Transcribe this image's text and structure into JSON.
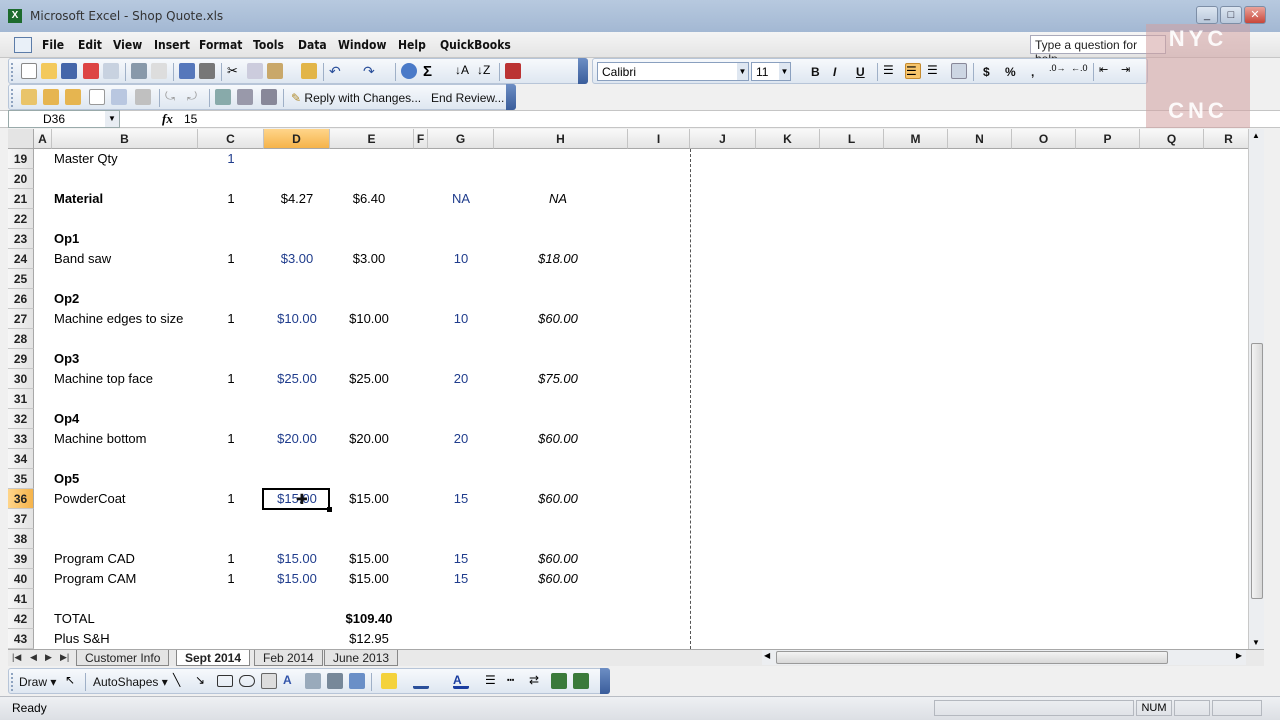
{
  "window": {
    "title": "Microsoft Excel - Shop Quote.xls",
    "app_icon": "excel-icon"
  },
  "menu": {
    "items": [
      "File",
      "Edit",
      "View",
      "Insert",
      "Format",
      "Tools",
      "Data",
      "Window",
      "Help",
      "QuickBooks"
    ],
    "help_placeholder": "Type a question for help"
  },
  "toolbar": {
    "font_name": "Calibri",
    "font_size": "11",
    "bold": "B",
    "italic": "I",
    "underline": "U",
    "currency": "$",
    "percent": "%",
    "comma": ",",
    "reply_label": "Reply with Changes...",
    "end_review_label": "End Review..."
  },
  "formula_bar": {
    "name_box": "D36",
    "fx": "fx",
    "value": "15"
  },
  "columns": [
    "A",
    "B",
    "C",
    "D",
    "E",
    "F",
    "G",
    "H",
    "I",
    "J",
    "K",
    "L",
    "M",
    "N",
    "O",
    "P",
    "Q",
    "R"
  ],
  "selected_column": "D",
  "selected_row": "36",
  "rows": [
    "19",
    "20",
    "21",
    "22",
    "23",
    "24",
    "25",
    "26",
    "27",
    "28",
    "29",
    "30",
    "31",
    "32",
    "33",
    "34",
    "35",
    "36",
    "37",
    "38",
    "39",
    "40",
    "41",
    "42",
    "43"
  ],
  "cells": {
    "r19": {
      "b": "Master Qty",
      "c": "1"
    },
    "r21": {
      "b": "Material",
      "c": "1",
      "d": "$4.27",
      "e": "$6.40",
      "g": "NA",
      "h": "NA"
    },
    "r23": {
      "b": "Op1"
    },
    "r24": {
      "b": "Band saw",
      "c": "1",
      "d": "$3.00",
      "e": "$3.00",
      "g": "10",
      "h": "$18.00"
    },
    "r26": {
      "b": "Op2"
    },
    "r27": {
      "b": "Machine edges to size",
      "c": "1",
      "d": "$10.00",
      "e": "$10.00",
      "g": "10",
      "h": "$60.00"
    },
    "r29": {
      "b": "Op3"
    },
    "r30": {
      "b": "Machine top face",
      "c": "1",
      "d": "$25.00",
      "e": "$25.00",
      "g": "20",
      "h": "$75.00"
    },
    "r32": {
      "b": "Op4"
    },
    "r33": {
      "b": "Machine bottom",
      "c": "1",
      "d": "$20.00",
      "e": "$20.00",
      "g": "20",
      "h": "$60.00"
    },
    "r35": {
      "b": "Op5"
    },
    "r36": {
      "b": "PowderCoat",
      "c": "1",
      "d": "$15.00",
      "e": "$15.00",
      "g": "15",
      "h": "$60.00"
    },
    "r39": {
      "b": "Program CAD",
      "c": "1",
      "d": "$15.00",
      "e": "$15.00",
      "g": "15",
      "h": "$60.00"
    },
    "r40": {
      "b": "Program CAM",
      "c": "1",
      "d": "$15.00",
      "e": "$15.00",
      "g": "15",
      "h": "$60.00"
    },
    "r42": {
      "b": "TOTAL",
      "e": "$109.40"
    },
    "r43": {
      "b": "Plus S&H",
      "e": "$12.95"
    }
  },
  "sheets": [
    "Customer Info",
    "Sept 2014",
    "Feb 2014",
    "June 2013"
  ],
  "active_sheet": "Sept 2014",
  "draw_toolbar": {
    "draw_label": "Draw",
    "autoshapes_label": "AutoShapes"
  },
  "status": {
    "ready": "Ready",
    "num": "NUM"
  },
  "watermark": {
    "line1": "NYC",
    "line2": "CNC"
  }
}
